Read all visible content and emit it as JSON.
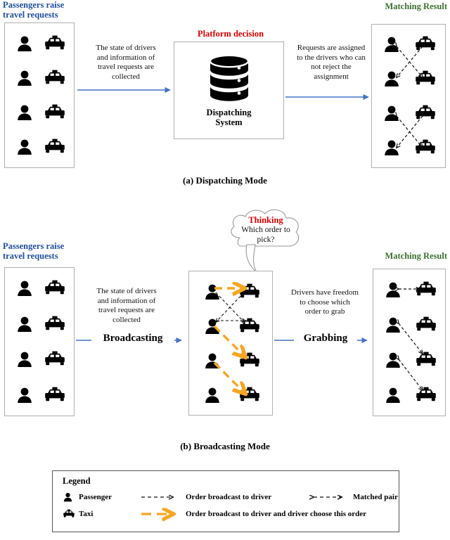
{
  "figure": {
    "panel_a_caption": "(a) Dispatching Mode",
    "panel_b_caption": "(b) Broadcasting Mode"
  },
  "colors": {
    "title_blue": "#1F4E9C",
    "title_green": "#3D7030",
    "title_red": "#D00000",
    "connector_blue": "#4472C4",
    "broadcast_orange": "#F5A623",
    "dashed_black": "#111111",
    "box_border": "#b0b0b0"
  },
  "panel_a": {
    "left": {
      "title": "Passengers raise\ntravel requests",
      "title_line1": "Passengers raise",
      "title_line2": "travel requests",
      "rows": 4,
      "icons": [
        "passenger-icon",
        "taxi-icon"
      ]
    },
    "arrow1_text": "The state of drivers and information of travel requests are collected",
    "arrow1_lines": [
      "The state of drivers",
      "and information of",
      "travel requests are",
      "collected"
    ],
    "center": {
      "title": "Platform decision",
      "icon": "database-icon",
      "label_line1": "Dispatching",
      "label_line2": "System"
    },
    "arrow2_text": "Requests are assigned to the drivers who can not reject the assignment",
    "arrow2_lines": [
      "Requests are assigned",
      "to the drivers who can",
      "not reject the",
      "assignment"
    ],
    "right": {
      "title": "Matching Result",
      "rows": 4,
      "pairs": "crossed matched pairs"
    }
  },
  "panel_b": {
    "left": {
      "title_line1": "Passengers raise",
      "title_line2": "travel requests",
      "rows": 4,
      "icons": [
        "passenger-icon",
        "taxi-icon"
      ]
    },
    "arrow1_lines": [
      "The state of drivers",
      "and information of",
      "travel requests are",
      "collected"
    ],
    "arrow1_label": "Broadcasting",
    "bubble": {
      "title": "Thinking",
      "line1": "Which order to",
      "line2": "pick?"
    },
    "center": {
      "rows": 4
    },
    "arrow2_lines": [
      "Drivers have freedom",
      "to choose which",
      "order to grab"
    ],
    "arrow2_label": "Grabbing",
    "right": {
      "title": "Matching Result",
      "rows": 4
    }
  },
  "legend": {
    "heading": "Legend",
    "rows": [
      {
        "icon": "passenger-icon",
        "icon_label": "Passenger",
        "line_style": "black-dashed-arrow",
        "line_label": "Order broadcast to driver",
        "line_style_2": "black-dashed-double-arrow",
        "line_label_2": "Matched pair"
      },
      {
        "icon": "taxi-icon",
        "icon_label": "Taxi",
        "line_style": "orange-dashed-arrow",
        "line_label": "Order broadcast to driver and driver choose this order"
      }
    ]
  }
}
